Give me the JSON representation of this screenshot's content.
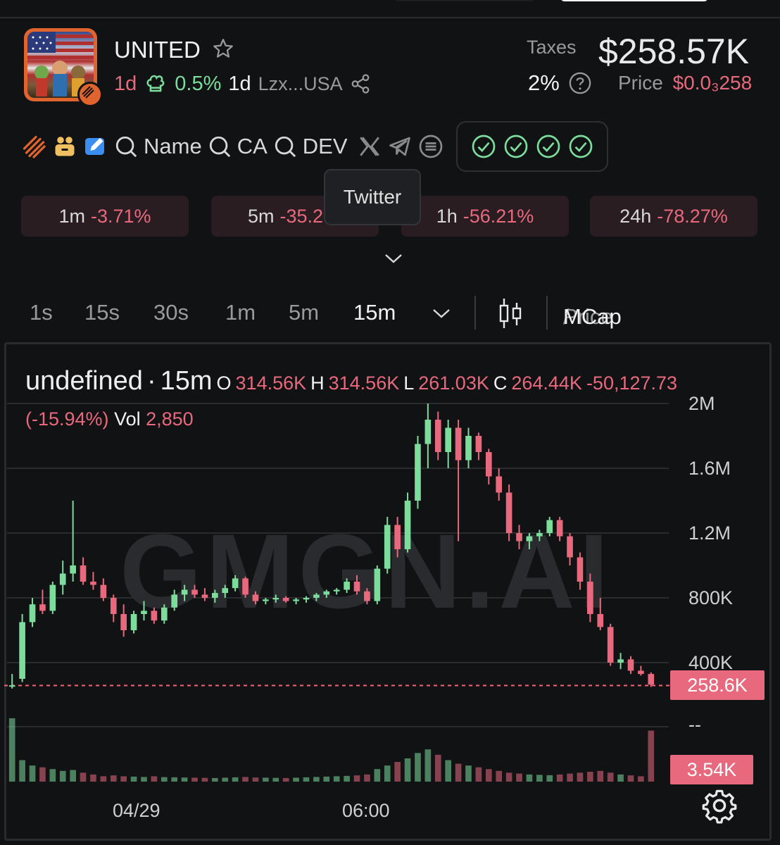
{
  "token": {
    "name": "UNITED",
    "age": "1d",
    "holder_pct": "0.5%",
    "holder_age": "1d",
    "address": "Lzx...USA"
  },
  "taxes": {
    "label": "Taxes",
    "value": "2%"
  },
  "market_cap": "$258.57K",
  "price": {
    "label": "Price",
    "value": "$0.0₃258"
  },
  "toolbar": {
    "search_name": "Name",
    "search_ca": "CA",
    "search_dev": "DEV"
  },
  "tooltip": "Twitter",
  "changes": [
    {
      "period": "1m",
      "value": "-3.71%"
    },
    {
      "period": "5m",
      "value": "-35.2…"
    },
    {
      "period": "1h",
      "value": "-56.21%"
    },
    {
      "period": "24h",
      "value": "-78.27%"
    }
  ],
  "intervals": [
    "1s",
    "15s",
    "30s",
    "1m",
    "5m",
    "15m"
  ],
  "selected_interval": "15m",
  "mode": {
    "price": "Price",
    "sep": "/",
    "mcap": "MCap"
  },
  "colors": {
    "up": "#7bdc9c",
    "down": "#e8697d",
    "accent_red": "#e8697d"
  },
  "legend": {
    "symbol": "undefined",
    "interval": "15m",
    "o_label": "O",
    "o": "314.56K",
    "h_label": "H",
    "h": "314.56K",
    "l_label": "L",
    "l": "261.03K",
    "c_label": "C",
    "c": "264.44K",
    "change": "-50,127.73",
    "change_pct": "(-15.94%)",
    "vol_label": "Vol",
    "vol": "2,850"
  },
  "watermark": "GMGN.AI",
  "y_ticks": [
    "2M",
    "1.6M",
    "1.2M",
    "800K",
    "400K",
    "--"
  ],
  "price_tag": "258.6K",
  "volume_tag": "3.54K",
  "x_ticks": [
    "04/29",
    "06:00"
  ],
  "chart_data": {
    "type": "candlestick",
    "ylim": [
      0,
      2200000
    ],
    "last_price": 258600,
    "candles": [
      [
        260000,
        330000,
        240000,
        260000
      ],
      [
        300000,
        700000,
        280000,
        650000
      ],
      [
        650000,
        800000,
        620000,
        760000
      ],
      [
        760000,
        850000,
        700000,
        720000
      ],
      [
        720000,
        900000,
        700000,
        880000
      ],
      [
        880000,
        1030000,
        820000,
        950000
      ],
      [
        950000,
        1400000,
        900000,
        1000000
      ],
      [
        1000000,
        1050000,
        880000,
        900000
      ],
      [
        900000,
        960000,
        850000,
        880000
      ],
      [
        880000,
        920000,
        780000,
        800000
      ],
      [
        800000,
        820000,
        650000,
        700000
      ],
      [
        700000,
        760000,
        560000,
        600000
      ],
      [
        600000,
        720000,
        580000,
        700000
      ],
      [
        700000,
        780000,
        660000,
        720000
      ],
      [
        720000,
        740000,
        640000,
        660000
      ],
      [
        660000,
        760000,
        640000,
        740000
      ],
      [
        740000,
        850000,
        720000,
        820000
      ],
      [
        820000,
        880000,
        780000,
        850000
      ],
      [
        850000,
        880000,
        800000,
        820000
      ],
      [
        820000,
        860000,
        780000,
        800000
      ],
      [
        800000,
        850000,
        770000,
        830000
      ],
      [
        830000,
        880000,
        800000,
        860000
      ],
      [
        860000,
        940000,
        840000,
        920000
      ],
      [
        920000,
        930000,
        800000,
        820000
      ],
      [
        820000,
        840000,
        760000,
        780000
      ],
      [
        780000,
        800000,
        760000,
        790000
      ],
      [
        790000,
        820000,
        770000,
        800000
      ],
      [
        800000,
        810000,
        770000,
        780000
      ],
      [
        780000,
        800000,
        760000,
        790000
      ],
      [
        790000,
        810000,
        770000,
        800000
      ],
      [
        800000,
        830000,
        780000,
        820000
      ],
      [
        820000,
        850000,
        800000,
        840000
      ],
      [
        840000,
        860000,
        820000,
        850000
      ],
      [
        850000,
        920000,
        830000,
        900000
      ],
      [
        900000,
        940000,
        820000,
        840000
      ],
      [
        840000,
        860000,
        760000,
        780000
      ],
      [
        780000,
        1000000,
        760000,
        980000
      ],
      [
        980000,
        1300000,
        950000,
        1250000
      ],
      [
        1250000,
        1300000,
        1050000,
        1100000
      ],
      [
        1100000,
        1450000,
        1080000,
        1400000
      ],
      [
        1400000,
        1800000,
        1350000,
        1750000
      ],
      [
        1750000,
        2000000,
        1600000,
        1900000
      ],
      [
        1900000,
        1950000,
        1650000,
        1700000
      ],
      [
        1700000,
        1900000,
        1600000,
        1850000
      ],
      [
        1850000,
        1900000,
        1150000,
        1650000
      ],
      [
        1650000,
        1850000,
        1600000,
        1800000
      ],
      [
        1800000,
        1820000,
        1650000,
        1700000
      ],
      [
        1700000,
        1720000,
        1500000,
        1550000
      ],
      [
        1550000,
        1600000,
        1400000,
        1450000
      ],
      [
        1450000,
        1500000,
        1150000,
        1200000
      ],
      [
        1200000,
        1250000,
        1100000,
        1150000
      ],
      [
        1150000,
        1200000,
        1100000,
        1180000
      ],
      [
        1180000,
        1220000,
        1150000,
        1200000
      ],
      [
        1200000,
        1300000,
        1180000,
        1280000
      ],
      [
        1280000,
        1300000,
        1150000,
        1180000
      ],
      [
        1180000,
        1200000,
        1000000,
        1050000
      ],
      [
        1050000,
        1080000,
        850000,
        900000
      ],
      [
        900000,
        950000,
        650000,
        700000
      ],
      [
        700000,
        800000,
        600000,
        620000
      ],
      [
        620000,
        640000,
        380000,
        400000
      ],
      [
        400000,
        460000,
        360000,
        420000
      ],
      [
        420000,
        440000,
        330000,
        350000
      ],
      [
        350000,
        380000,
        320000,
        330000
      ],
      [
        330000,
        340000,
        250000,
        264440
      ]
    ],
    "volume": [
      3540,
      1200,
      900,
      800,
      700,
      600,
      650,
      500,
      400,
      300,
      350,
      300,
      280,
      260,
      300,
      250,
      240,
      230,
      220,
      210,
      200,
      220,
      240,
      260,
      230,
      220,
      210,
      200,
      220,
      240,
      260,
      280,
      300,
      320,
      350,
      400,
      700,
      900,
      1100,
      1300,
      1600,
      1800,
      1500,
      1200,
      1000,
      900,
      800,
      700,
      600,
      500,
      450,
      400,
      380,
      360,
      400,
      450,
      500,
      550,
      600,
      500,
      400,
      350,
      300,
      2850
    ]
  }
}
